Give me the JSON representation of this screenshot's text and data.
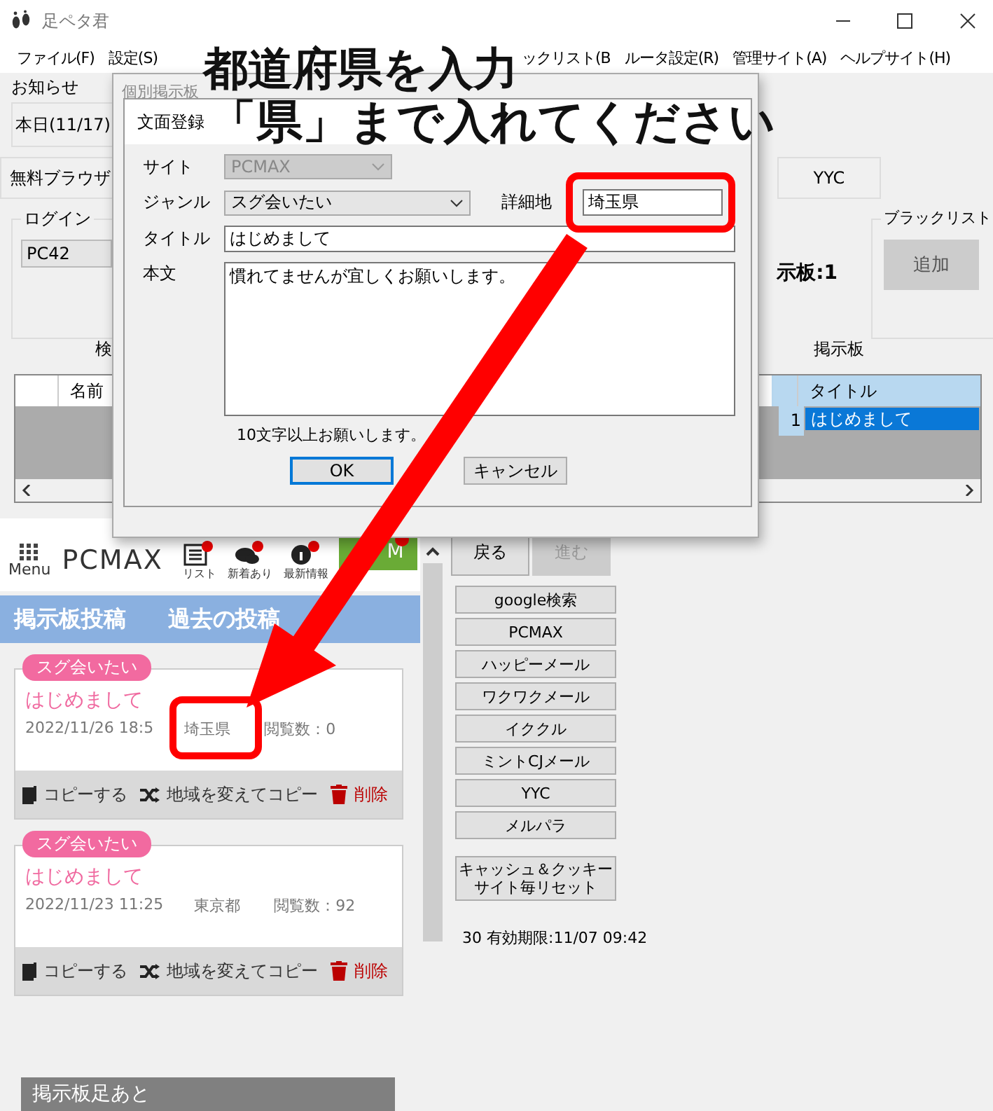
{
  "window": {
    "title": "足ペタ君"
  },
  "menu": [
    "ファイル(F)",
    "設定(S)",
    "ックリスト(B",
    "ルータ設定(R)",
    "管理サイト(A)",
    "ヘルプサイト(H)"
  ],
  "notice": {
    "label": "お知らせ",
    "text": "本日(11/17)"
  },
  "tabs": [
    {
      "label": "無料ブラウザ",
      "selected": false
    },
    {
      "label": "YYC",
      "selected": false
    }
  ],
  "login": {
    "label": "ログイン",
    "account": "PC42"
  },
  "board_count": "示板:1",
  "blacklist": {
    "label": "ブラックリスト",
    "button": "追加"
  },
  "section_labels": [
    "検",
    "掲示板"
  ],
  "table": {
    "left_columns": [
      "名前"
    ],
    "right_columns": [
      "タイトル"
    ],
    "rows": [
      {
        "number": "1",
        "title": "はじめまして",
        "selected": true
      }
    ]
  },
  "web": {
    "menu_label": "Menu",
    "logo": "PCMAX",
    "header_icons": [
      {
        "kind": "list",
        "label": "リスト"
      },
      {
        "kind": "chat",
        "label": "新着あり"
      },
      {
        "kind": "info",
        "label": "最新情報"
      }
    ],
    "green_button": "M",
    "breadcrumb": [
      "掲示板投稿",
      "過去の投稿"
    ],
    "posts": [
      {
        "tag": "スグ会いたい",
        "title": "はじめまして",
        "date": "2022/11/26 18:5",
        "area": "埼玉県",
        "views": "閲覧数：0",
        "actions": {
          "copy": "コピーする",
          "copy_area": "地域を変えてコピー",
          "delete": "削除"
        }
      },
      {
        "tag": "スグ会いたい",
        "title": "はじめまして",
        "date": "2022/11/23 11:25",
        "area": "東京都",
        "views": "閲覧数：92",
        "actions": {
          "copy": "コピーする",
          "copy_area": "地域を変えてコピー",
          "delete": "削除"
        }
      }
    ],
    "footer": "掲示板足あと"
  },
  "nav": [
    {
      "label": "戻る",
      "disabled": false
    },
    {
      "label": "進む",
      "disabled": true
    }
  ],
  "site_buttons": [
    "google検索",
    "PCMAX",
    "ハッピーメール",
    "ワクワクメール",
    "イククル",
    "ミントCJメール",
    "YYC",
    "メルパラ"
  ],
  "reset_button": [
    "キャッシュ＆クッキー",
    "サイト毎リセット"
  ],
  "expiry": "30 有効期限:11/07 09:42",
  "back_dialog": {
    "title": "個別掲示板"
  },
  "dialog": {
    "title": "文面登録",
    "site": {
      "label": "サイト",
      "value": "PCMAX",
      "disabled": true
    },
    "genre": {
      "label": "ジャンル",
      "value": "スグ会いたい",
      "disabled": false
    },
    "area": {
      "label": "詳細地",
      "value": "埼玉県"
    },
    "title_field": {
      "label": "タイトル",
      "value": "はじめまして"
    },
    "body": {
      "label": "本文",
      "value": "慣れてませんが宜しくお願いします。"
    },
    "hint": "10文字以上お願いします。",
    "buttons": [
      {
        "label": "OK",
        "focused": true
      },
      {
        "label": "キャンセル",
        "focused": false
      }
    ]
  },
  "annotation": {
    "lines": [
      "都道府県を入力",
      "「県」まで入れてください"
    ]
  }
}
